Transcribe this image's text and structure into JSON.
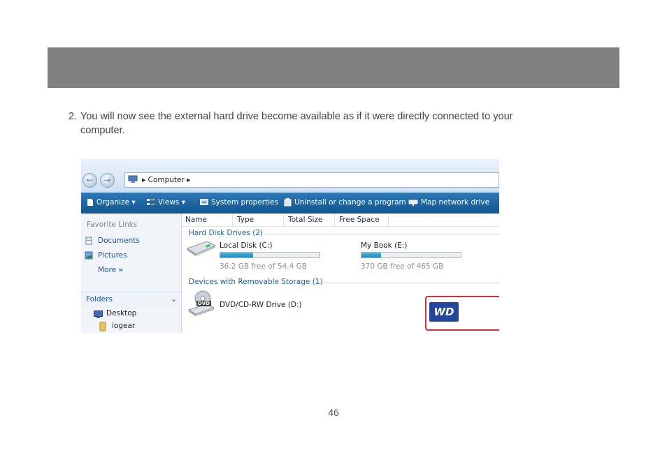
{
  "step": {
    "number": "2.",
    "text_line1": "You will now see the external hard drive become available as if it were directly connected to your",
    "text_line2": "computer."
  },
  "page_number": "46",
  "explorer": {
    "breadcrumb": "Computer",
    "toolbar": {
      "organize": "Organize",
      "views": "Views",
      "system_properties": "System properties",
      "uninstall": "Uninstall or change a program",
      "map_drive": "Map network drive"
    },
    "nav": {
      "favorite_links": "Favorite Links",
      "documents": "Documents",
      "pictures": "Pictures",
      "more": "More",
      "folders": "Folders",
      "desktop": "Desktop",
      "iogear": "iogear"
    },
    "columns": [
      "Name",
      "Type",
      "Total Size",
      "Free Space"
    ],
    "groups": {
      "hard_disk": "Hard Disk Drives (2)",
      "removable": "Devices with Removable Storage (1)"
    },
    "drives": [
      {
        "name": "Local Disk (C:)",
        "free_text": "36.2 GB free of 54.4 GB",
        "used_fraction": 0.33
      },
      {
        "name": "My Book (E:)",
        "free_text": "370 GB free of 465 GB",
        "used_fraction": 0.2,
        "logo": "WD"
      }
    ],
    "dvd": {
      "name": "DVD/CD-RW Drive (D:)",
      "label": "DVD"
    },
    "colors": {
      "highlight": "#d6313b",
      "toolbar": "#1a62a3",
      "wd_blue": "#24479b"
    }
  }
}
